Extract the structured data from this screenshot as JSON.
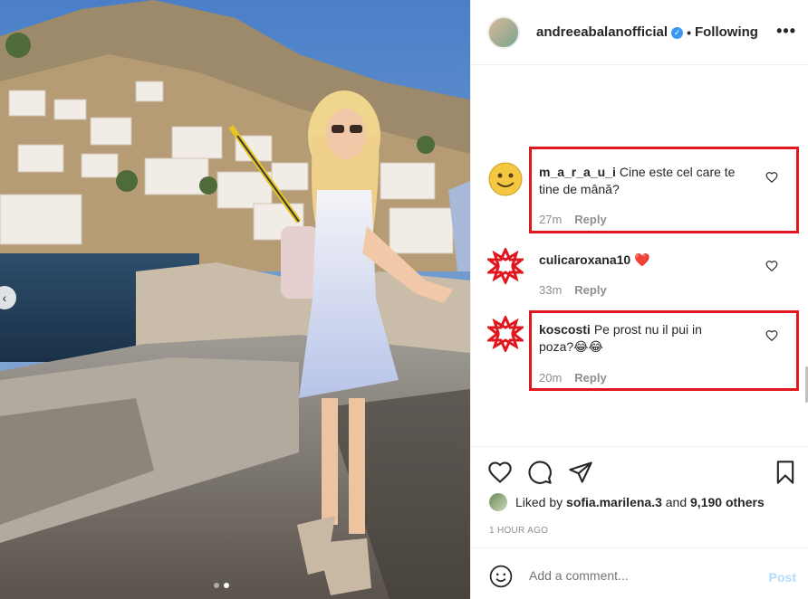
{
  "header": {
    "username": "andreeabalanofficial",
    "verified_mark": "✓",
    "separator": "•",
    "follow_status": "Following",
    "more_icon": "more-icon"
  },
  "comments": [
    {
      "user": "m_a_r_a_u_i",
      "text": "Cine este cel care te tine de mână?",
      "time": "27m",
      "reply": "Reply",
      "avatar": "smiley-emoji-avatar"
    },
    {
      "user": "culicaroxana10",
      "text": "❤️",
      "time": "33m",
      "reply": "Reply",
      "avatar": "red-star-avatar"
    },
    {
      "user": "koscosti",
      "text": "Pe prost nu il pui in poza?😂😂",
      "time": "20m",
      "reply": "Reply",
      "avatar": "red-star-avatar"
    }
  ],
  "likes": {
    "prefix": "Liked by",
    "user": "sofia.marilena.3",
    "middle": "and",
    "count": "9,190 others"
  },
  "time_ago": "1 HOUR AGO",
  "add_comment": {
    "placeholder": "Add a comment...",
    "post_label": "Post"
  },
  "colors": {
    "highlight": "#e0171f",
    "post_disabled": "#b3dbff",
    "verified": "#3897f0"
  }
}
